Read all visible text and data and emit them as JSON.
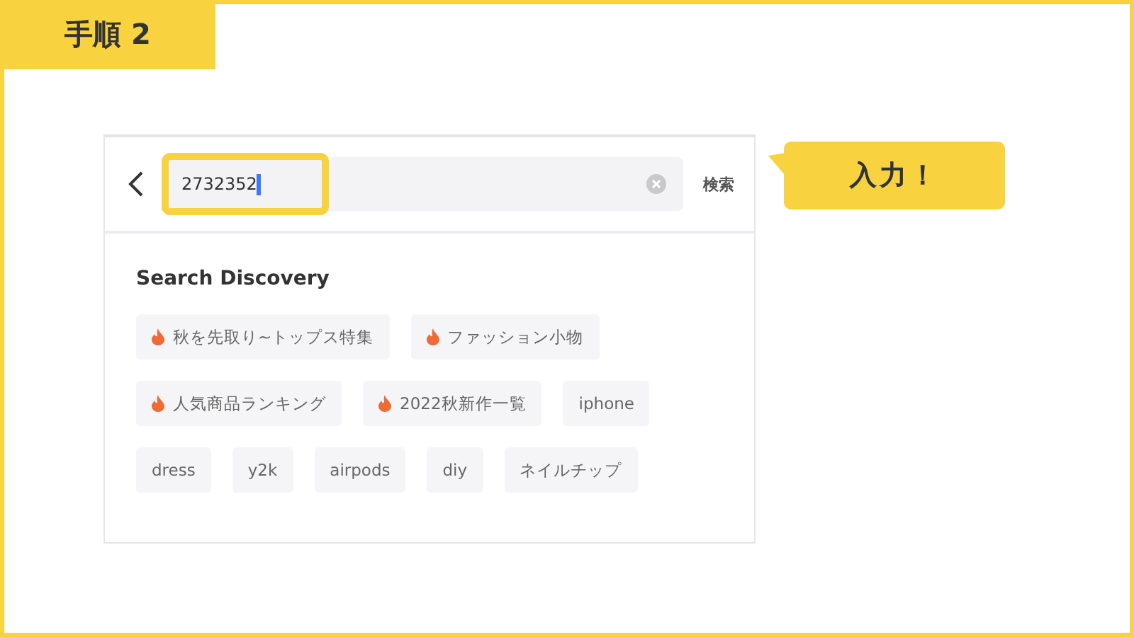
{
  "step_label": "手順 2",
  "search_bar": {
    "value": "2732352",
    "submit": "検索"
  },
  "callout": "入力！",
  "discovery": {
    "title": "Search Discovery",
    "tag_rows": [
      [
        {
          "label": "秋を先取り~トップス特集",
          "kind": "hot"
        },
        {
          "label": "ファッション小物",
          "kind": "hot"
        }
      ],
      [
        {
          "label": "人気商品ランキング",
          "kind": "hot"
        },
        {
          "label": "2022秋新作一覧",
          "kind": "hot"
        },
        {
          "label": "iphone",
          "kind": "plain"
        }
      ],
      [
        {
          "label": "dress",
          "kind": "plain"
        },
        {
          "label": "y2k",
          "kind": "plain"
        },
        {
          "label": "airpods",
          "kind": "plain"
        },
        {
          "label": "diy",
          "kind": "plain"
        },
        {
          "label": "ネイルチップ",
          "kind": "plain"
        }
      ]
    ]
  }
}
